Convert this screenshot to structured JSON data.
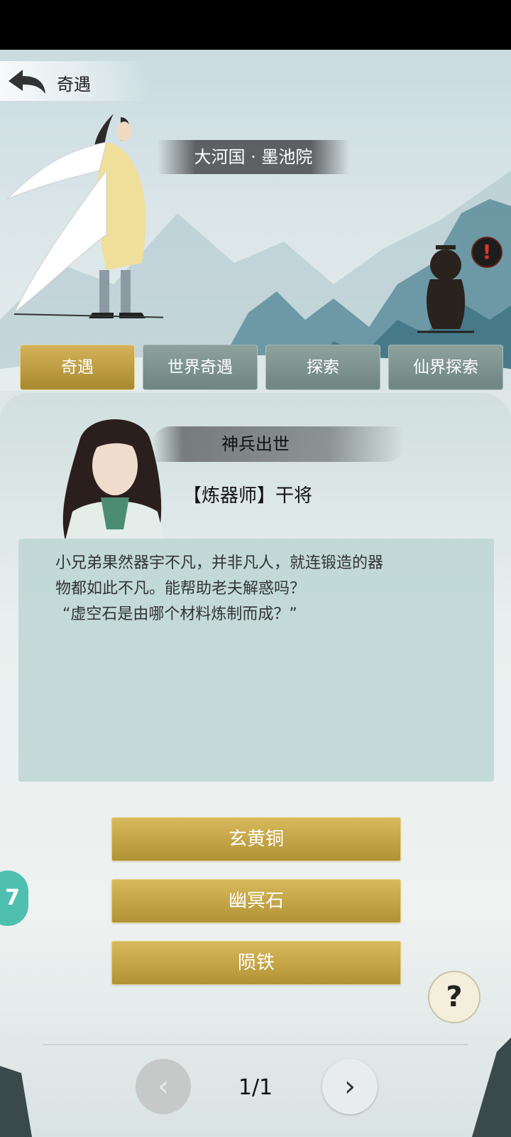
{
  "header": {
    "title": "奇遇",
    "location": "大河国 · 墨池院"
  },
  "tabs": [
    {
      "label": "奇遇",
      "active": true
    },
    {
      "label": "世界奇遇",
      "active": false
    },
    {
      "label": "探索",
      "active": false
    },
    {
      "label": "仙界探索",
      "active": false
    }
  ],
  "npc_alert": "!",
  "event": {
    "title": "神兵出世",
    "npc_name": "【炼器师】干将",
    "dialog_lines": [
      "小兄弟果然器宇不凡，并非凡人，就连锻造的器",
      "物都如此不凡。能帮助老夫解惑吗？",
      "“虚空石是由哪个材料炼制而成？”"
    ]
  },
  "options": [
    "玄黄铜",
    "幽冥石",
    "陨铁"
  ],
  "help": "?",
  "side_badge": "7",
  "pager": {
    "text": "1/1",
    "prev": "‹",
    "next": "›"
  },
  "colors": {
    "gold": "#c4a447",
    "tab_inactive": "#7d918e",
    "dialog_bg": "#bcd6d3"
  }
}
